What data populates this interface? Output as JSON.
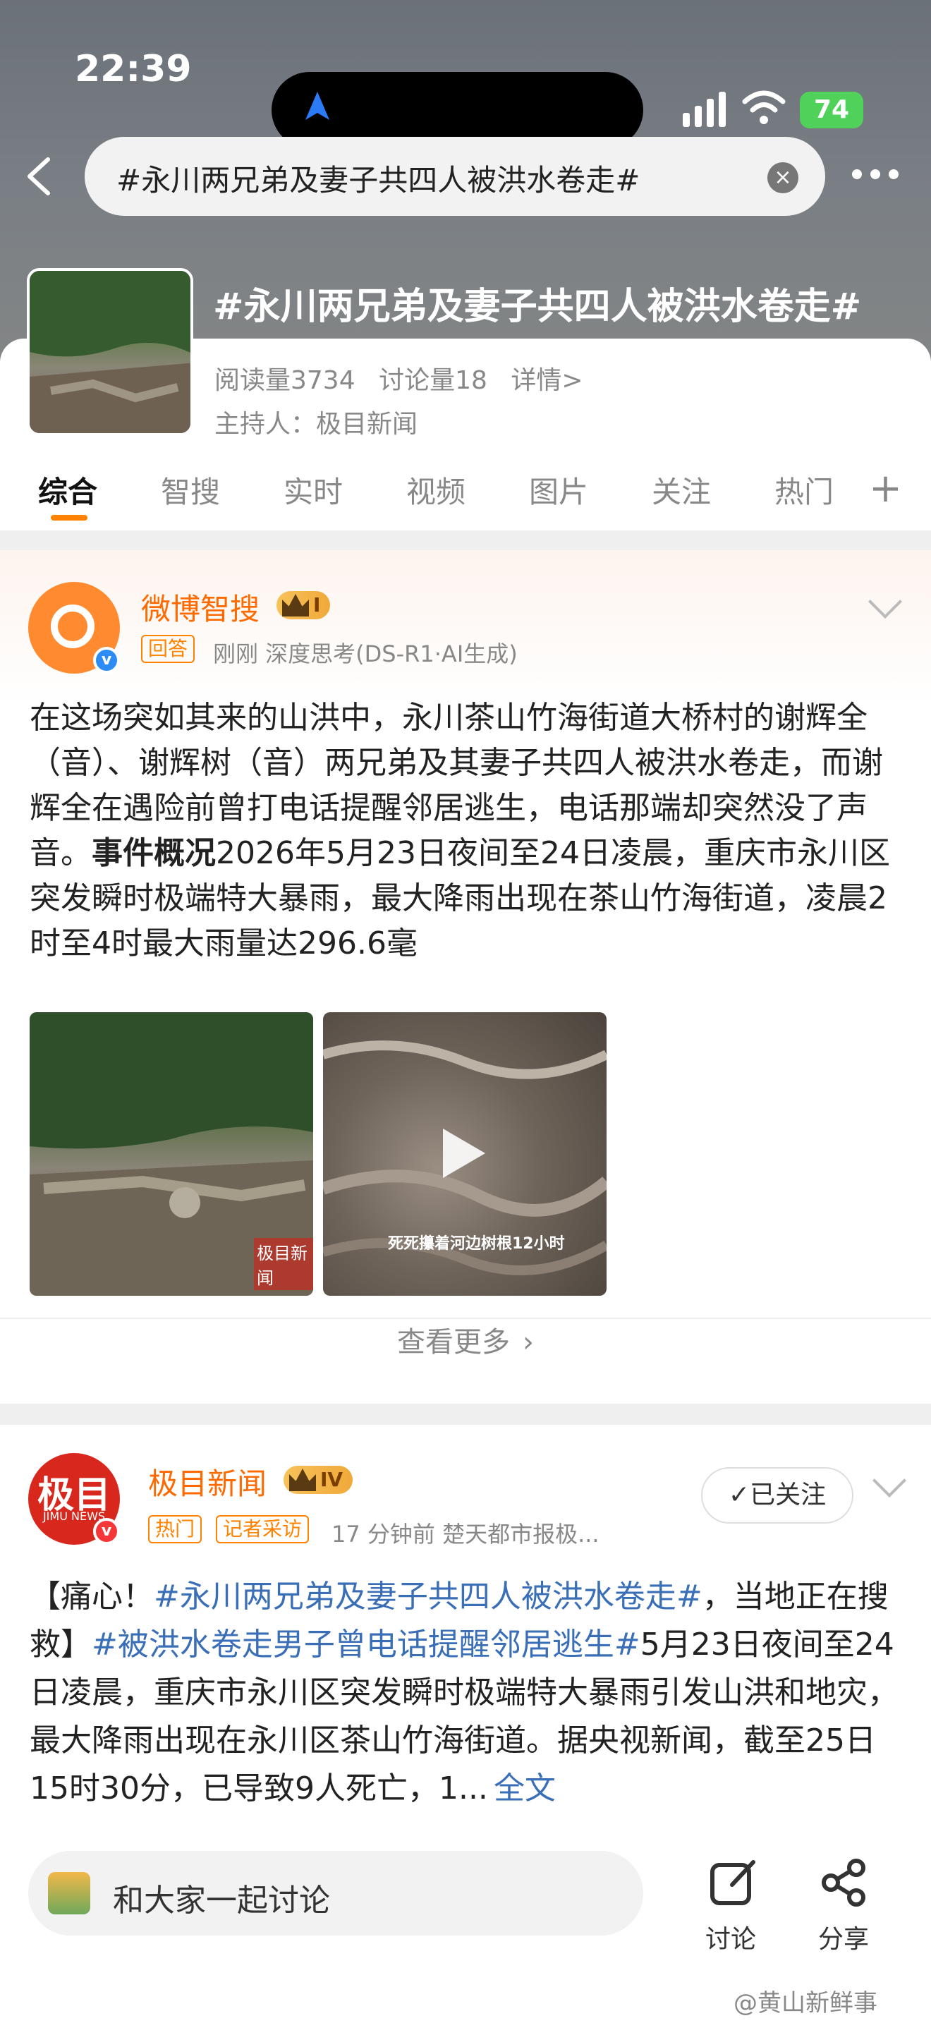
{
  "status_bar": {
    "time": "22:39",
    "battery": "74"
  },
  "search": {
    "query": "#永川两兄弟及妻子共四人被洪水卷走#"
  },
  "topic": {
    "title": "#永川两兄弟及妻子共四人被洪水卷走#",
    "reads": "阅读量3734",
    "discussions": "讨论量18",
    "details": "详情>",
    "host": "主持人：极目新闻"
  },
  "tabs": [
    "综合",
    "智搜",
    "实时",
    "视频",
    "图片",
    "关注",
    "热门"
  ],
  "colors": {
    "accent": "#ff8200",
    "link": "#3a6fb8",
    "verified": "#2c8cf4"
  },
  "post1": {
    "user": "微博智搜",
    "vip_level": "I",
    "tag": "回答",
    "meta": "刚刚  深度思考(DS-R1·AI生成)",
    "text_plain": "在这场突如其来的山洪中，永川茶山竹海街道大桥村的谢辉全（音）、谢辉树（音）两兄弟及其妻子共四人被洪水卷走，而谢辉全在遇险前曾打电话提醒邻居逃生，电话那端却突然没了声音。",
    "text_bold": "事件概况",
    "text_rest": "2026年5月23日夜间至24日凌晨，重庆市永川区突发瞬时极端特大暴雨，最大降雨出现在茶山竹海街道，凌晨2时至4时最大雨量达296.6毫",
    "image1_caption": "极目新闻",
    "image2_caption": "死死攥着河边树根12小时",
    "see_more": "查看更多"
  },
  "post2": {
    "user": "极目新闻",
    "vip_level": "IV",
    "avatar_text": "极目",
    "avatar_sub": "JIMU NEWS",
    "tag1": "热门",
    "tag2": "记者采访",
    "meta": "17 分钟前  楚天都市报极...",
    "follow": "✓已关注",
    "text_1": "【痛心！",
    "link_1": "#永川两兄弟及妻子共四人被洪水卷走#",
    "text_2": "，当地正在搜救】",
    "link_2": "#被洪水卷走男子曾电话提醒邻居逃生#",
    "text_3": "5月23日夜间至24日凌晨，重庆市永川区突发瞬时极端特大暴雨引发山洪和地灾，最大降雨出现在永川区茶山竹海街道。据央视新闻，截至25日15时30分，已导致9人死亡，1...",
    "full_text": "全文"
  },
  "bottom_bar": {
    "placeholder": "和大家一起讨论",
    "discuss": "讨论",
    "share": "分享",
    "watermark": "@黄山新鲜事"
  }
}
